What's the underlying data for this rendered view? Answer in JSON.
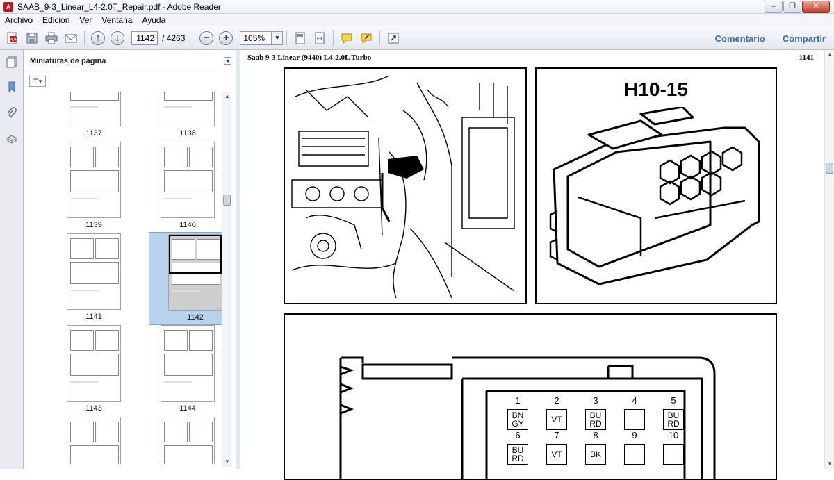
{
  "window": {
    "title": "SAAB_9-3_Linear_L4-2.0T_Repair.pdf - Adobe Reader",
    "minimize": "–",
    "restore": "❐",
    "close": "✕"
  },
  "menu": {
    "items": [
      "Archivo",
      "Edición",
      "Ver",
      "Ventana",
      "Ayuda"
    ]
  },
  "toolbar": {
    "page_current": "1142",
    "page_total": "/ 4263",
    "zoom": "105%",
    "comment_label": "Comentario",
    "share_label": "Compartir"
  },
  "panel": {
    "title": "Miniaturas de página"
  },
  "thumbnails": [
    {
      "label": "1137"
    },
    {
      "label": "1138"
    },
    {
      "label": "1139"
    },
    {
      "label": "1140"
    },
    {
      "label": "1141"
    },
    {
      "label": "1142",
      "selected": true
    },
    {
      "label": "1143"
    },
    {
      "label": "1144"
    },
    {
      "label": "",
      "partial": true
    },
    {
      "label": "",
      "partial": true
    }
  ],
  "document": {
    "header_left": "Saab 9-3 Linear (9440) L4-2.0L Turbo",
    "header_right": "1141",
    "connector_title": "H10-15",
    "pins": [
      {
        "num": "1",
        "color": "BN\nGY"
      },
      {
        "num": "2",
        "color": "VT"
      },
      {
        "num": "3",
        "color": "BU\nRD"
      },
      {
        "num": "4",
        "color": ""
      },
      {
        "num": "5",
        "color": "BU\nRD"
      },
      {
        "num": "6",
        "color": "BU\nRD"
      },
      {
        "num": "7",
        "color": "VT"
      },
      {
        "num": "8",
        "color": "BK"
      },
      {
        "num": "9",
        "color": ""
      },
      {
        "num": "10",
        "color": ""
      }
    ]
  },
  "colors": {
    "accent_blue": "#3d6aa6",
    "toolbar_bg": "#e4e9f0",
    "selection_bg": "#b9d3ec",
    "doc_bg": "#7b8796"
  }
}
